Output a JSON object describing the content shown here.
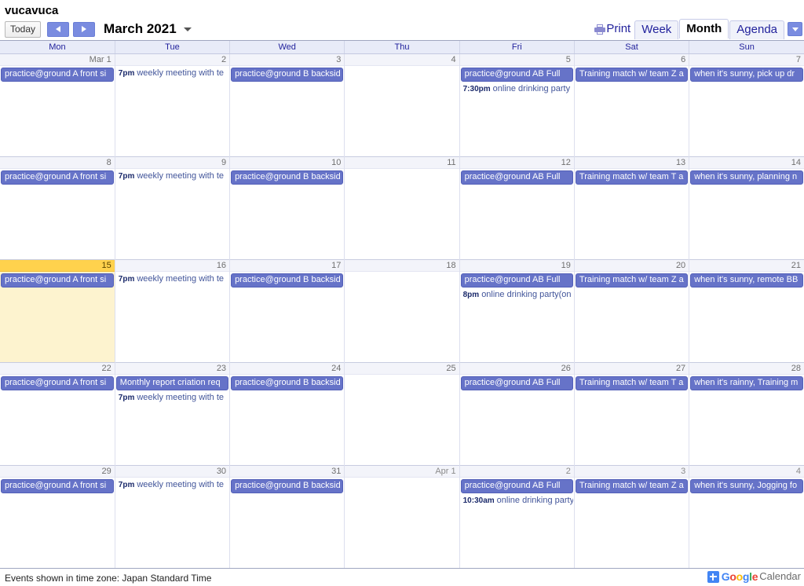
{
  "calendar": {
    "title": "vucavuca"
  },
  "toolbar": {
    "today_label": "Today",
    "prev_label": "Previous period",
    "next_label": "Next period",
    "range_label": "March 2021",
    "range_caret": "dropdown",
    "print_label": "Print",
    "views": [
      {
        "label": "Week",
        "active": false
      },
      {
        "label": "Month",
        "active": true
      },
      {
        "label": "Agenda",
        "active": false
      }
    ],
    "view_caret": "dropdown"
  },
  "weekday_headers": [
    "Mon",
    "Tue",
    "Wed",
    "Thu",
    "Fri",
    "Sat",
    "Sun"
  ],
  "footer": {
    "timezone_note": "Events shown in time zone: Japan Standard Time",
    "brand_google": "Google",
    "brand_calendar": "Calendar"
  },
  "colors": {
    "event_chip": "#6673c8",
    "event_chip_border": "#525fb8",
    "timed_event_text": "#42559a",
    "today_header": "#ffd24d",
    "today_body": "#fdf3cf",
    "header_row": "#e8ebf8",
    "header_text": "#22229c",
    "daynum_bar": "#f3f4fa"
  },
  "weeks": [
    {
      "days": [
        {
          "num": "Mar 1",
          "today": false,
          "othermonth": false,
          "events": [
            {
              "type": "chip",
              "title": "practice@ground A front si"
            }
          ]
        },
        {
          "num": "2",
          "today": false,
          "othermonth": false,
          "events": [
            {
              "type": "timed",
              "time": "7pm",
              "title": "weekly meeting with te"
            }
          ]
        },
        {
          "num": "3",
          "today": false,
          "othermonth": false,
          "events": [
            {
              "type": "chip",
              "title": "practice@ground B backsid"
            }
          ]
        },
        {
          "num": "4",
          "today": false,
          "othermonth": false,
          "events": []
        },
        {
          "num": "5",
          "today": false,
          "othermonth": false,
          "events": [
            {
              "type": "chip",
              "title": "practice@ground AB Full"
            },
            {
              "type": "timed",
              "time": "7:30pm",
              "title": "online drinking party"
            }
          ]
        },
        {
          "num": "6",
          "today": false,
          "othermonth": false,
          "events": [
            {
              "type": "chip",
              "title": "Training match w/ team Z a"
            }
          ]
        },
        {
          "num": "7",
          "today": false,
          "othermonth": false,
          "events": [
            {
              "type": "chip",
              "title": "when it's sunny, pick up dr"
            }
          ]
        }
      ]
    },
    {
      "days": [
        {
          "num": "8",
          "today": false,
          "othermonth": false,
          "events": [
            {
              "type": "chip",
              "title": "practice@ground A front si"
            }
          ]
        },
        {
          "num": "9",
          "today": false,
          "othermonth": false,
          "events": [
            {
              "type": "timed",
              "time": "7pm",
              "title": "weekly meeting with te"
            }
          ]
        },
        {
          "num": "10",
          "today": false,
          "othermonth": false,
          "events": [
            {
              "type": "chip",
              "title": "practice@ground B backsid"
            }
          ]
        },
        {
          "num": "11",
          "today": false,
          "othermonth": false,
          "events": []
        },
        {
          "num": "12",
          "today": false,
          "othermonth": false,
          "events": [
            {
              "type": "chip",
              "title": "practice@ground AB Full"
            }
          ]
        },
        {
          "num": "13",
          "today": false,
          "othermonth": false,
          "events": [
            {
              "type": "chip",
              "title": "Training match w/ team T a"
            }
          ]
        },
        {
          "num": "14",
          "today": false,
          "othermonth": false,
          "events": [
            {
              "type": "chip",
              "title": "when it's sunny, planning n"
            }
          ]
        }
      ]
    },
    {
      "days": [
        {
          "num": "15",
          "today": true,
          "othermonth": false,
          "events": [
            {
              "type": "chip",
              "title": "practice@ground A front si"
            }
          ]
        },
        {
          "num": "16",
          "today": false,
          "othermonth": false,
          "events": [
            {
              "type": "timed",
              "time": "7pm",
              "title": "weekly meeting with te"
            }
          ]
        },
        {
          "num": "17",
          "today": false,
          "othermonth": false,
          "events": [
            {
              "type": "chip",
              "title": "practice@ground B backsid"
            }
          ]
        },
        {
          "num": "18",
          "today": false,
          "othermonth": false,
          "events": []
        },
        {
          "num": "19",
          "today": false,
          "othermonth": false,
          "events": [
            {
              "type": "chip",
              "title": "practice@ground AB Full"
            },
            {
              "type": "timed",
              "time": "8pm",
              "title": "online drinking party(on"
            }
          ]
        },
        {
          "num": "20",
          "today": false,
          "othermonth": false,
          "events": [
            {
              "type": "chip",
              "title": "Training match w/ team Z a"
            }
          ]
        },
        {
          "num": "21",
          "today": false,
          "othermonth": false,
          "events": [
            {
              "type": "chip",
              "title": "when it's sunny, remote BB"
            }
          ]
        }
      ]
    },
    {
      "days": [
        {
          "num": "22",
          "today": false,
          "othermonth": false,
          "events": [
            {
              "type": "chip",
              "title": "practice@ground A front si"
            }
          ]
        },
        {
          "num": "23",
          "today": false,
          "othermonth": false,
          "events": [
            {
              "type": "chip",
              "title": "Monthly report criation req"
            },
            {
              "type": "timed",
              "time": "7pm",
              "title": "weekly meeting with te"
            }
          ]
        },
        {
          "num": "24",
          "today": false,
          "othermonth": false,
          "events": [
            {
              "type": "chip",
              "title": "practice@ground B backsid"
            }
          ]
        },
        {
          "num": "25",
          "today": false,
          "othermonth": false,
          "events": []
        },
        {
          "num": "26",
          "today": false,
          "othermonth": false,
          "events": [
            {
              "type": "chip",
              "title": "practice@ground AB Full"
            }
          ]
        },
        {
          "num": "27",
          "today": false,
          "othermonth": false,
          "events": [
            {
              "type": "chip",
              "title": "Training match w/ team T a"
            }
          ]
        },
        {
          "num": "28",
          "today": false,
          "othermonth": false,
          "events": [
            {
              "type": "chip",
              "title": "when it's rainny, Training m"
            }
          ]
        }
      ]
    },
    {
      "days": [
        {
          "num": "29",
          "today": false,
          "othermonth": false,
          "events": [
            {
              "type": "chip",
              "title": "practice@ground A front si"
            }
          ]
        },
        {
          "num": "30",
          "today": false,
          "othermonth": false,
          "events": [
            {
              "type": "timed",
              "time": "7pm",
              "title": "weekly meeting with te"
            }
          ]
        },
        {
          "num": "31",
          "today": false,
          "othermonth": false,
          "events": [
            {
              "type": "chip",
              "title": "practice@ground B backsid"
            }
          ]
        },
        {
          "num": "Apr 1",
          "today": false,
          "othermonth": true,
          "events": []
        },
        {
          "num": "2",
          "today": false,
          "othermonth": true,
          "events": [
            {
              "type": "chip",
              "title": "practice@ground AB Full"
            },
            {
              "type": "timed",
              "time": "10:30am",
              "title": "online drinking party"
            }
          ]
        },
        {
          "num": "3",
          "today": false,
          "othermonth": true,
          "events": [
            {
              "type": "chip",
              "title": "Training match w/ team Z a"
            }
          ]
        },
        {
          "num": "4",
          "today": false,
          "othermonth": true,
          "events": [
            {
              "type": "chip",
              "title": "when it's sunny, Jogging fo"
            }
          ]
        }
      ]
    }
  ]
}
